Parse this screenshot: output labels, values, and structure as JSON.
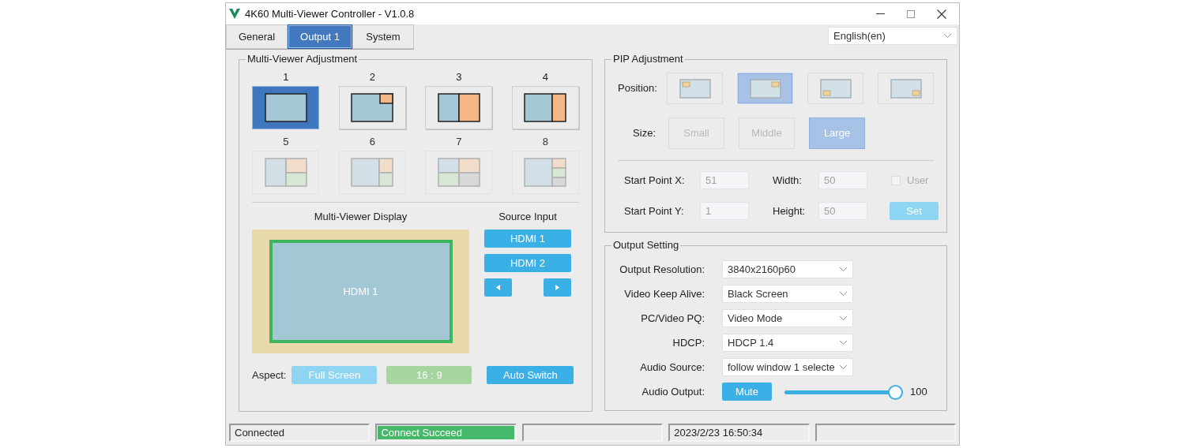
{
  "window": {
    "title": "4K60 Multi-Viewer Controller - V1.0.8"
  },
  "tabs": [
    {
      "label": "General",
      "selected": false
    },
    {
      "label": "Output 1",
      "selected": true
    },
    {
      "label": "System",
      "selected": false
    }
  ],
  "language": {
    "value": "English(en)"
  },
  "multi_viewer": {
    "title": "Multi-Viewer Adjustment",
    "layouts": [
      {
        "label": "1",
        "kind": "single",
        "selected": true,
        "disabled": false
      },
      {
        "label": "2",
        "kind": "pip",
        "selected": false,
        "disabled": false
      },
      {
        "label": "3",
        "kind": "half",
        "selected": false,
        "disabled": false
      },
      {
        "label": "4",
        "kind": "wide",
        "selected": false,
        "disabled": false
      },
      {
        "label": "5",
        "kind": "tri-left",
        "selected": false,
        "disabled": true
      },
      {
        "label": "6",
        "kind": "tri-wide",
        "selected": false,
        "disabled": true
      },
      {
        "label": "7",
        "kind": "quad",
        "selected": false,
        "disabled": true
      },
      {
        "label": "8",
        "kind": "quad-wide",
        "selected": false,
        "disabled": true
      }
    ],
    "display_title": "Multi-Viewer Display",
    "windows": [
      {
        "label": "HDMI 1",
        "selected": true
      }
    ],
    "source_title": "Source Input",
    "sources": [
      "HDMI 1",
      "HDMI 2"
    ],
    "aspect_label": "Aspect:",
    "aspects": [
      {
        "label": "Full Screen",
        "color": "#8dd5f3"
      },
      {
        "label": "16 : 9",
        "color": "#a6d5a0"
      }
    ],
    "auto_switch": "Auto Switch"
  },
  "pip": {
    "title": "PIP Adjustment",
    "position_label": "Position:",
    "positions": [
      {
        "kind": "top-left",
        "selected": false
      },
      {
        "kind": "top-right",
        "selected": true
      },
      {
        "kind": "bottom-left",
        "selected": false
      },
      {
        "kind": "bottom-right",
        "selected": false
      }
    ],
    "size_label": "Size:",
    "sizes": [
      {
        "label": "Small",
        "selected": false
      },
      {
        "label": "Middle",
        "selected": false
      },
      {
        "label": "Large",
        "selected": true
      }
    ],
    "fields": [
      {
        "label": "Start Point X:",
        "value": "51",
        "disabled": true
      },
      {
        "label": "Width:",
        "value": "50",
        "disabled": true
      },
      {
        "label": "Start Point Y:",
        "value": "1",
        "disabled": true
      },
      {
        "label": "Height:",
        "value": "50",
        "disabled": true
      }
    ],
    "user": {
      "label": "User",
      "checked": false
    },
    "set_button": "Set"
  },
  "output": {
    "title": "Output Setting",
    "settings": [
      {
        "label": "Output Resolution:",
        "value": "3840x2160p60"
      },
      {
        "label": "Video Keep Alive:",
        "value": "Black Screen"
      },
      {
        "label": "PC/Video PQ:",
        "value": "Video Mode"
      },
      {
        "label": "HDCP:",
        "value": "HDCP 1.4"
      },
      {
        "label": "Audio Source:",
        "value": "follow window 1 selecte"
      }
    ],
    "audio_label": "Audio Output:",
    "mute": "Mute",
    "volume": {
      "level": 1.0,
      "reading": "100"
    }
  },
  "status_bar": [
    {
      "text": "Connected",
      "ok": false
    },
    {
      "text": "Connect Succeed",
      "ok": true
    },
    {
      "ok": false
    },
    {
      "text": "2023/2/23 16:50:34",
      "ok": false
    },
    {
      "ok": false
    }
  ]
}
